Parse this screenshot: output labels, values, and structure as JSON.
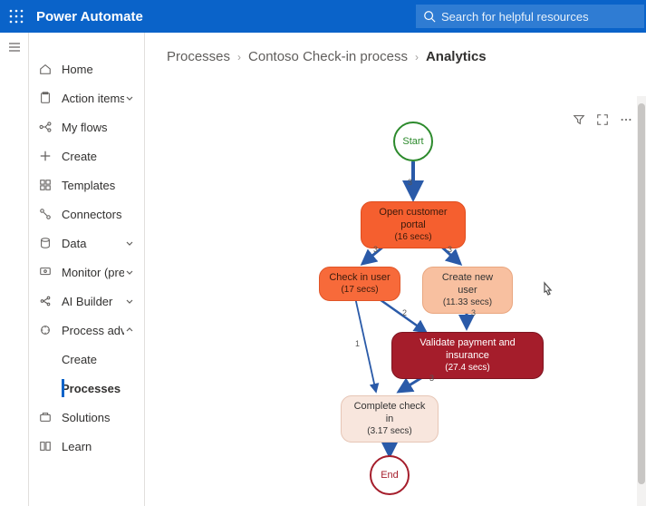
{
  "header": {
    "brand": "Power Automate",
    "search_placeholder": "Search for helpful resources"
  },
  "sidebar": {
    "items": [
      {
        "icon": "home",
        "label": "Home"
      },
      {
        "icon": "clipboard",
        "label": "Action items",
        "chevron": "down"
      },
      {
        "icon": "flow",
        "label": "My flows"
      },
      {
        "icon": "plus",
        "label": "Create"
      },
      {
        "icon": "template",
        "label": "Templates"
      },
      {
        "icon": "connector",
        "label": "Connectors"
      },
      {
        "icon": "data",
        "label": "Data",
        "chevron": "down"
      },
      {
        "icon": "monitor",
        "label": "Monitor (preview)",
        "chevron": "down"
      },
      {
        "icon": "ai",
        "label": "AI Builder",
        "chevron": "down"
      },
      {
        "icon": "process",
        "label": "Process advisor (preview)",
        "chevron": "up"
      }
    ],
    "sub_process": [
      {
        "label": "Create"
      },
      {
        "label": "Processes",
        "active": true
      }
    ],
    "tail": [
      {
        "icon": "solutions",
        "label": "Solutions"
      },
      {
        "icon": "learn",
        "label": "Learn"
      }
    ]
  },
  "breadcrumb": {
    "a": "Processes",
    "b": "Contoso Check-in process",
    "c": "Analytics"
  },
  "toolbar": {
    "filter": "Filter",
    "expand": "Focus mode",
    "more": "More"
  },
  "diagram": {
    "start": "Start",
    "end": "End",
    "nodes": {
      "n1": {
        "title": "Open customer portal",
        "meta": "(16 secs)"
      },
      "n2": {
        "title": "Check in user",
        "meta": "(17 secs)"
      },
      "n3": {
        "title": "Create new user",
        "meta": "(11.33 secs)"
      },
      "n4": {
        "title": "Validate payment and insurance",
        "meta": "(27.4 secs)"
      },
      "n5": {
        "title": "Complete check in",
        "meta": "(3.17 secs)"
      }
    },
    "edge_labels": {
      "e1": "3",
      "e2": "3",
      "e3": "3",
      "e4": "2",
      "e5": "3",
      "e6": "3",
      "e7": "1"
    }
  },
  "colors": {
    "brand": "#0a63c9",
    "n1": "#f55f2f",
    "n1b": "#e04d1e",
    "n2": "#f76a3a",
    "n2b": "#e05528",
    "n3": "#f8c0a0",
    "n3b": "#e9a67f",
    "n4": "#a51d2b",
    "n4b": "#7e1521",
    "n4t": "#fff",
    "n5": "#f8e6dd",
    "n5b": "#e6c6b6",
    "start": "#2c8a2c",
    "end": "#a51d2b",
    "arrow": "#2a5aa8"
  }
}
